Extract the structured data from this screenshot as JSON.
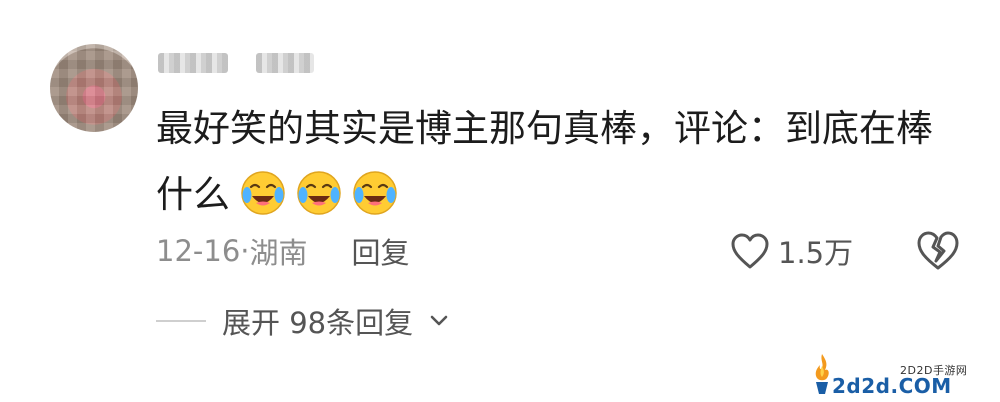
{
  "comment": {
    "text_line1": "最好笑的其实是博主那句真棒，评论：到底在棒",
    "text_line2": "什么",
    "emojis": [
      "crying-laughing-emoji",
      "crying-laughing-emoji",
      "crying-laughing-emoji"
    ],
    "date": "12-16",
    "separator": "·",
    "location": "湖南",
    "reply_label": "回复",
    "like_count": "1.5万",
    "expand_label": "展开 98条回复"
  },
  "watermark": {
    "small_text": "2D2D手游网",
    "big_text": "2d2d.COM"
  },
  "colors": {
    "text_primary": "#1c1c1c",
    "text_meta": "#8d8d8d",
    "text_action": "#555555",
    "emoji_face": "#ffcc33",
    "watermark_blue": "#1a5ea6"
  }
}
